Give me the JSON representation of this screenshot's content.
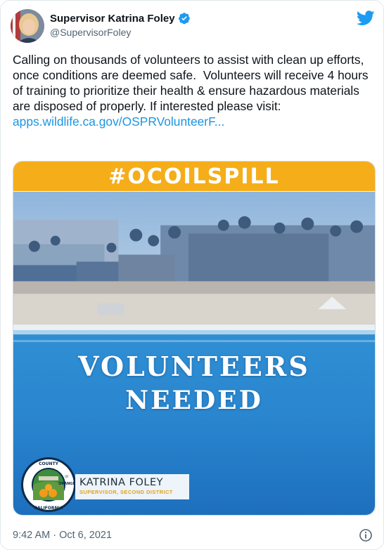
{
  "tweet": {
    "display_name": "Supervisor Katrina Foley",
    "handle": "@SupervisorFoley",
    "body": "Calling on thousands of volunteers to assist with clean up efforts, once conditions are deemed safe.  Volunteers will receive 4 hours of training to prioritize their health & ensure hazardous materials are disposed of properly. If interested please visit:",
    "link_text": "apps.wildlife.ca.gov/OSPRVolunteerF...",
    "timestamp": "9:42 AM · Oct 6, 2021"
  },
  "media": {
    "banner_text": "#OCOILSPILL",
    "headline_line1": "VOLUNTEERS",
    "headline_line2": "NEEDED",
    "badge_name": "KATRINA FOLEY",
    "badge_title": "SUPERVISOR, SECOND DISTRICT",
    "seal_top_text": "COUNTY",
    "seal_mid_text": "OF",
    "seal_right_text": "ORANGE",
    "seal_bottom_text": "CALIFORNIA"
  },
  "icons": {
    "verified": "verified-badge-icon",
    "brand": "twitter-bird-icon",
    "info": "info-icon"
  },
  "colors": {
    "link": "#1b95e0",
    "banner": "#f5ae19",
    "brand": "#1d9bf0",
    "muted": "#536471"
  }
}
